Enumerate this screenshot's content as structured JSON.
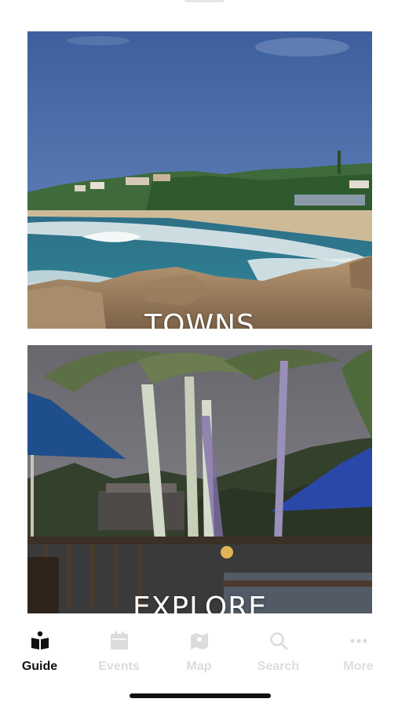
{
  "cards": [
    {
      "id": "towns",
      "label": "TOWNS"
    },
    {
      "id": "explore",
      "label": "EXPLORE"
    }
  ],
  "tab_bar": {
    "active": "Guide",
    "tabs": [
      {
        "label": "Guide",
        "icon": "open-book-icon"
      },
      {
        "label": "Events",
        "icon": "calendar-icon"
      },
      {
        "label": "Map",
        "icon": "map-icon"
      },
      {
        "label": "Search",
        "icon": "search-icon"
      },
      {
        "label": "More",
        "icon": "more-dots-icon"
      }
    ]
  },
  "colors": {
    "active_tab": "#111111",
    "inactive_tab": "#dcdcdc",
    "background": "#ffffff"
  }
}
